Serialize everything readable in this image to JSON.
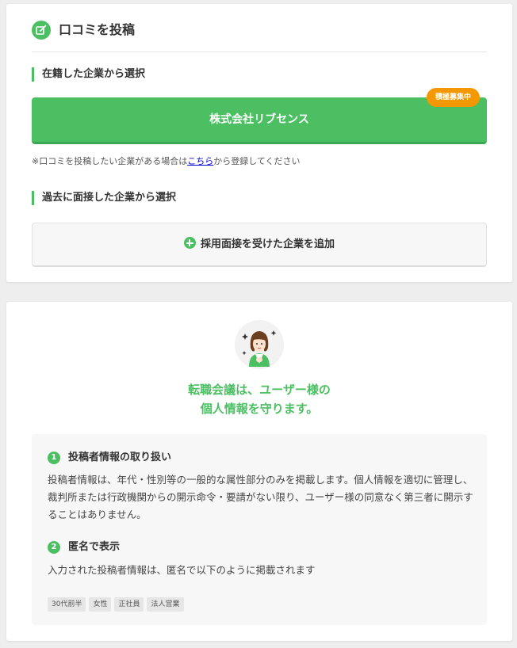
{
  "post_review": {
    "title": "口コミを投稿",
    "current_company_heading": "在籍した企業から選択",
    "company_name": "株式会社リブセンス",
    "recruit_badge": "積極募集中",
    "note_prefix": "※口コミを投稿したい企業がある場合は",
    "note_link": "こちら",
    "note_suffix": "から登録してください",
    "interview_heading": "過去に面接した企業から選択",
    "add_interview_button": "採用面接を受けた企業を追加"
  },
  "privacy": {
    "pledge_line1": "転職会議は、ユーザー様の",
    "pledge_line2": "個人情報を守ります。",
    "points": [
      {
        "number": "1",
        "title": "投稿者情報の取り扱い",
        "body": "投稿者情報は、年代・性別等の一般的な属性部分のみを掲載します。個人情報を適切に管理し、裁判所または行政機関からの開示命令・要請がない限り、ユーザー様の同意なく第三者に開示することはありません。"
      },
      {
        "number": "2",
        "title": "匿名で表示",
        "body": "入力された投稿者情報は、匿名で以下のように掲載されます"
      }
    ],
    "tags": [
      "30代前半",
      "女性",
      "正社員",
      "法人営業"
    ]
  },
  "colors": {
    "accent": "#4cbf63",
    "badge": "#f39800",
    "link": "#0000cc"
  },
  "icons": {
    "header": "edit-icon",
    "add": "plus-circle-icon",
    "avatar": "support-staff-illustration"
  }
}
